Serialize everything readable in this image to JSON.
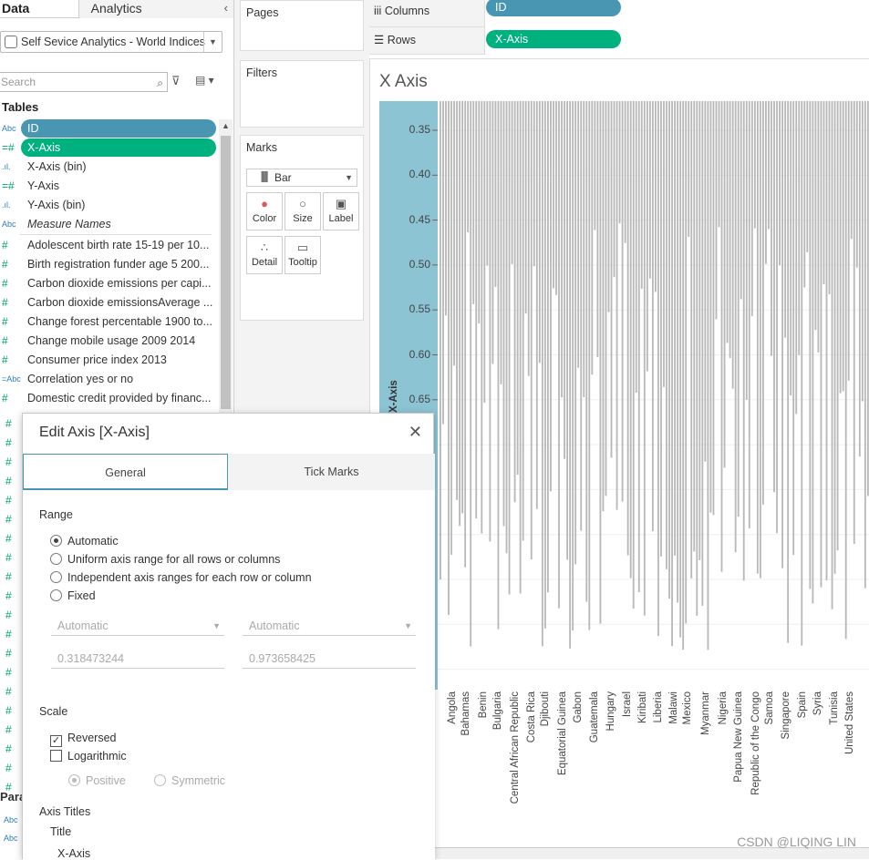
{
  "left_pane": {
    "tab_data": "Data",
    "tab_analytics": "Analytics",
    "datasource": "Self Sevice Analytics - World Indices",
    "search_placeholder": "Search",
    "tables_heading": "Tables",
    "parameters_heading": "Para",
    "fields": [
      {
        "type": "Abc",
        "name": "ID",
        "pill": "blue"
      },
      {
        "type": "=#",
        "name": "X-Axis",
        "pill": "green"
      },
      {
        "type": ".ıl.",
        "name": "X-Axis (bin)"
      },
      {
        "type": "=#",
        "name": "Y-Axis"
      },
      {
        "type": ".ıl.",
        "name": "Y-Axis (bin)"
      },
      {
        "type": "Abc",
        "name": "Measure Names",
        "italic": true
      },
      {
        "type": "#",
        "name": "Adolescent birth rate 15-19 per 10..."
      },
      {
        "type": "#",
        "name": "Birth registration funder age 5 200..."
      },
      {
        "type": "#",
        "name": "Carbon dioxide emissions per capi..."
      },
      {
        "type": "#",
        "name": "Carbon dioxide emissionsAverage ..."
      },
      {
        "type": "#",
        "name": "Change forest percentable 1900 to..."
      },
      {
        "type": "#",
        "name": "Change mobile usage 2009 2014"
      },
      {
        "type": "#",
        "name": "Consumer price index 2013"
      },
      {
        "type": "=Abc",
        "name": "Correlation yes or no"
      },
      {
        "type": "#",
        "name": "Domestic credit provided by financ..."
      }
    ]
  },
  "cards": {
    "pages": "Pages",
    "filters": "Filters",
    "marks": "Marks",
    "mark_type": "Bar",
    "buttons": [
      "Color",
      "Size",
      "Label",
      "Detail",
      "Tooltip"
    ]
  },
  "shelves": {
    "columns_label": "Columns",
    "rows_label": "Rows",
    "columns_pill": "ID",
    "rows_pill": "X-Axis"
  },
  "viz": {
    "title": "X Axis",
    "y_axis_title": "X-Axis",
    "y_ticks": [
      "0.35",
      "0.40",
      "0.45",
      "0.50",
      "0.55",
      "0.60",
      "0.65"
    ],
    "x_labels": [
      "Angola",
      "Bahamas",
      "Benin",
      "Bulgaria",
      "Central African Republic",
      "Costa Rica",
      "Djibouti",
      "Equatorial Guinea",
      "Gabon",
      "Guatemala",
      "Hungary",
      "Israel",
      "Kiribati",
      "Liberia",
      "Malawi",
      "Mexico",
      "Myanmar",
      "Nigeria",
      "Papua New Guinea",
      "Republic of the Congo",
      "Samoa",
      "Singapore",
      "Spain",
      "Syria",
      "Tunisia",
      "United States"
    ]
  },
  "dialog": {
    "title": "Edit Axis [X-Axis]",
    "tab_general": "General",
    "tab_tick_marks": "Tick Marks",
    "range_heading": "Range",
    "range_options": [
      "Automatic",
      "Uniform axis range for all rows or columns",
      "Independent axis ranges for each row or column",
      "Fixed"
    ],
    "start_select": "Automatic",
    "end_select": "Automatic",
    "start_value": "0.318473244",
    "end_value": "0.973658425",
    "scale_heading": "Scale",
    "reversed_label": "Reversed",
    "logarithmic_label": "Logarithmic",
    "positive_label": "Positive",
    "symmetric_label": "Symmetric",
    "axis_titles_heading": "Axis Titles",
    "title_label": "Title",
    "title_value": "X-Axis"
  },
  "watermark": "CSDN @LIQING LIN",
  "colors": {
    "id_pill": "#4996b2",
    "measure_pill": "#00b180",
    "bar": "#b8b8b8",
    "highlight": "#8cc4d4"
  }
}
